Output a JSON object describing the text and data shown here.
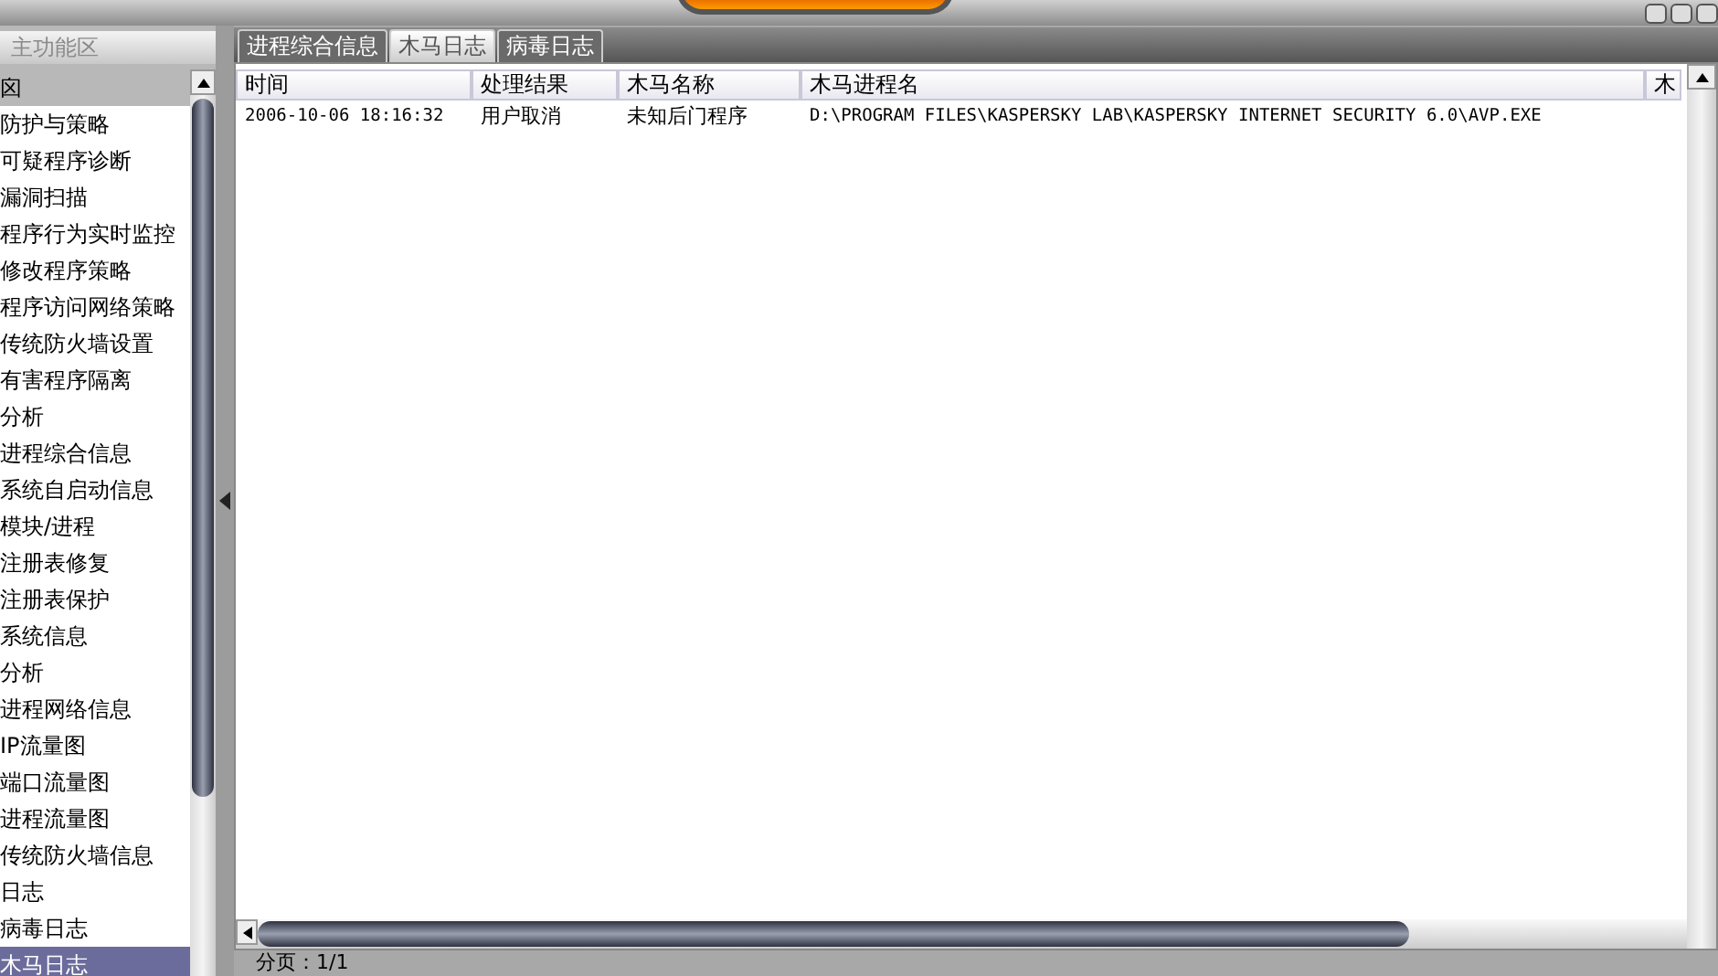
{
  "sidebar": {
    "title": "主功能区",
    "items": [
      {
        "label": "囟",
        "kind": "group",
        "selected": false
      },
      {
        "label": "防护与策略",
        "kind": "group",
        "selected": false
      },
      {
        "label": "可疑程序诊断",
        "kind": "item",
        "selected": false
      },
      {
        "label": "漏洞扫描",
        "kind": "item",
        "selected": false
      },
      {
        "label": "程序行为实时监控",
        "kind": "item",
        "selected": false
      },
      {
        "label": "修改程序策略",
        "kind": "item",
        "selected": false
      },
      {
        "label": "程序访问网络策略",
        "kind": "item",
        "selected": false
      },
      {
        "label": "传统防火墙设置",
        "kind": "item",
        "selected": false
      },
      {
        "label": "有害程序隔离",
        "kind": "item",
        "selected": false
      },
      {
        "label": "分析",
        "kind": "group",
        "selected": false
      },
      {
        "label": "进程综合信息",
        "kind": "item",
        "selected": false
      },
      {
        "label": "系统自启动信息",
        "kind": "item",
        "selected": false
      },
      {
        "label": "模块/进程",
        "kind": "item",
        "selected": false
      },
      {
        "label": "注册表修复",
        "kind": "item",
        "selected": false
      },
      {
        "label": "注册表保护",
        "kind": "item",
        "selected": false
      },
      {
        "label": "系统信息",
        "kind": "item",
        "selected": false
      },
      {
        "label": "分析",
        "kind": "group",
        "selected": false
      },
      {
        "label": "进程网络信息",
        "kind": "item",
        "selected": false
      },
      {
        "label": "IP流量图",
        "kind": "item",
        "selected": false
      },
      {
        "label": "端口流量图",
        "kind": "item",
        "selected": false
      },
      {
        "label": "进程流量图",
        "kind": "item",
        "selected": false
      },
      {
        "label": "传统防火墙信息",
        "kind": "item",
        "selected": false
      },
      {
        "label": "日志",
        "kind": "group",
        "selected": false
      },
      {
        "label": "病毒日志",
        "kind": "item",
        "selected": false
      },
      {
        "label": "木马日志",
        "kind": "item",
        "selected": true
      }
    ]
  },
  "tabs": [
    {
      "label": "进程综合信息",
      "selected": false
    },
    {
      "label": "木马日志",
      "selected": true
    },
    {
      "label": "病毒日志",
      "selected": false
    }
  ],
  "table": {
    "columns": [
      "时间",
      "处理结果",
      "木马名称",
      "木马进程名",
      "木"
    ],
    "rows": [
      [
        "2006-10-06 18:16:32",
        "用户取消",
        "未知后门程序",
        "D:\\PROGRAM FILES\\KASPERSKY LAB\\KASPERSKY INTERNET SECURITY 6.0\\AVP.EXE"
      ]
    ]
  },
  "status_bar": {
    "paging": "分页：1/1"
  }
}
